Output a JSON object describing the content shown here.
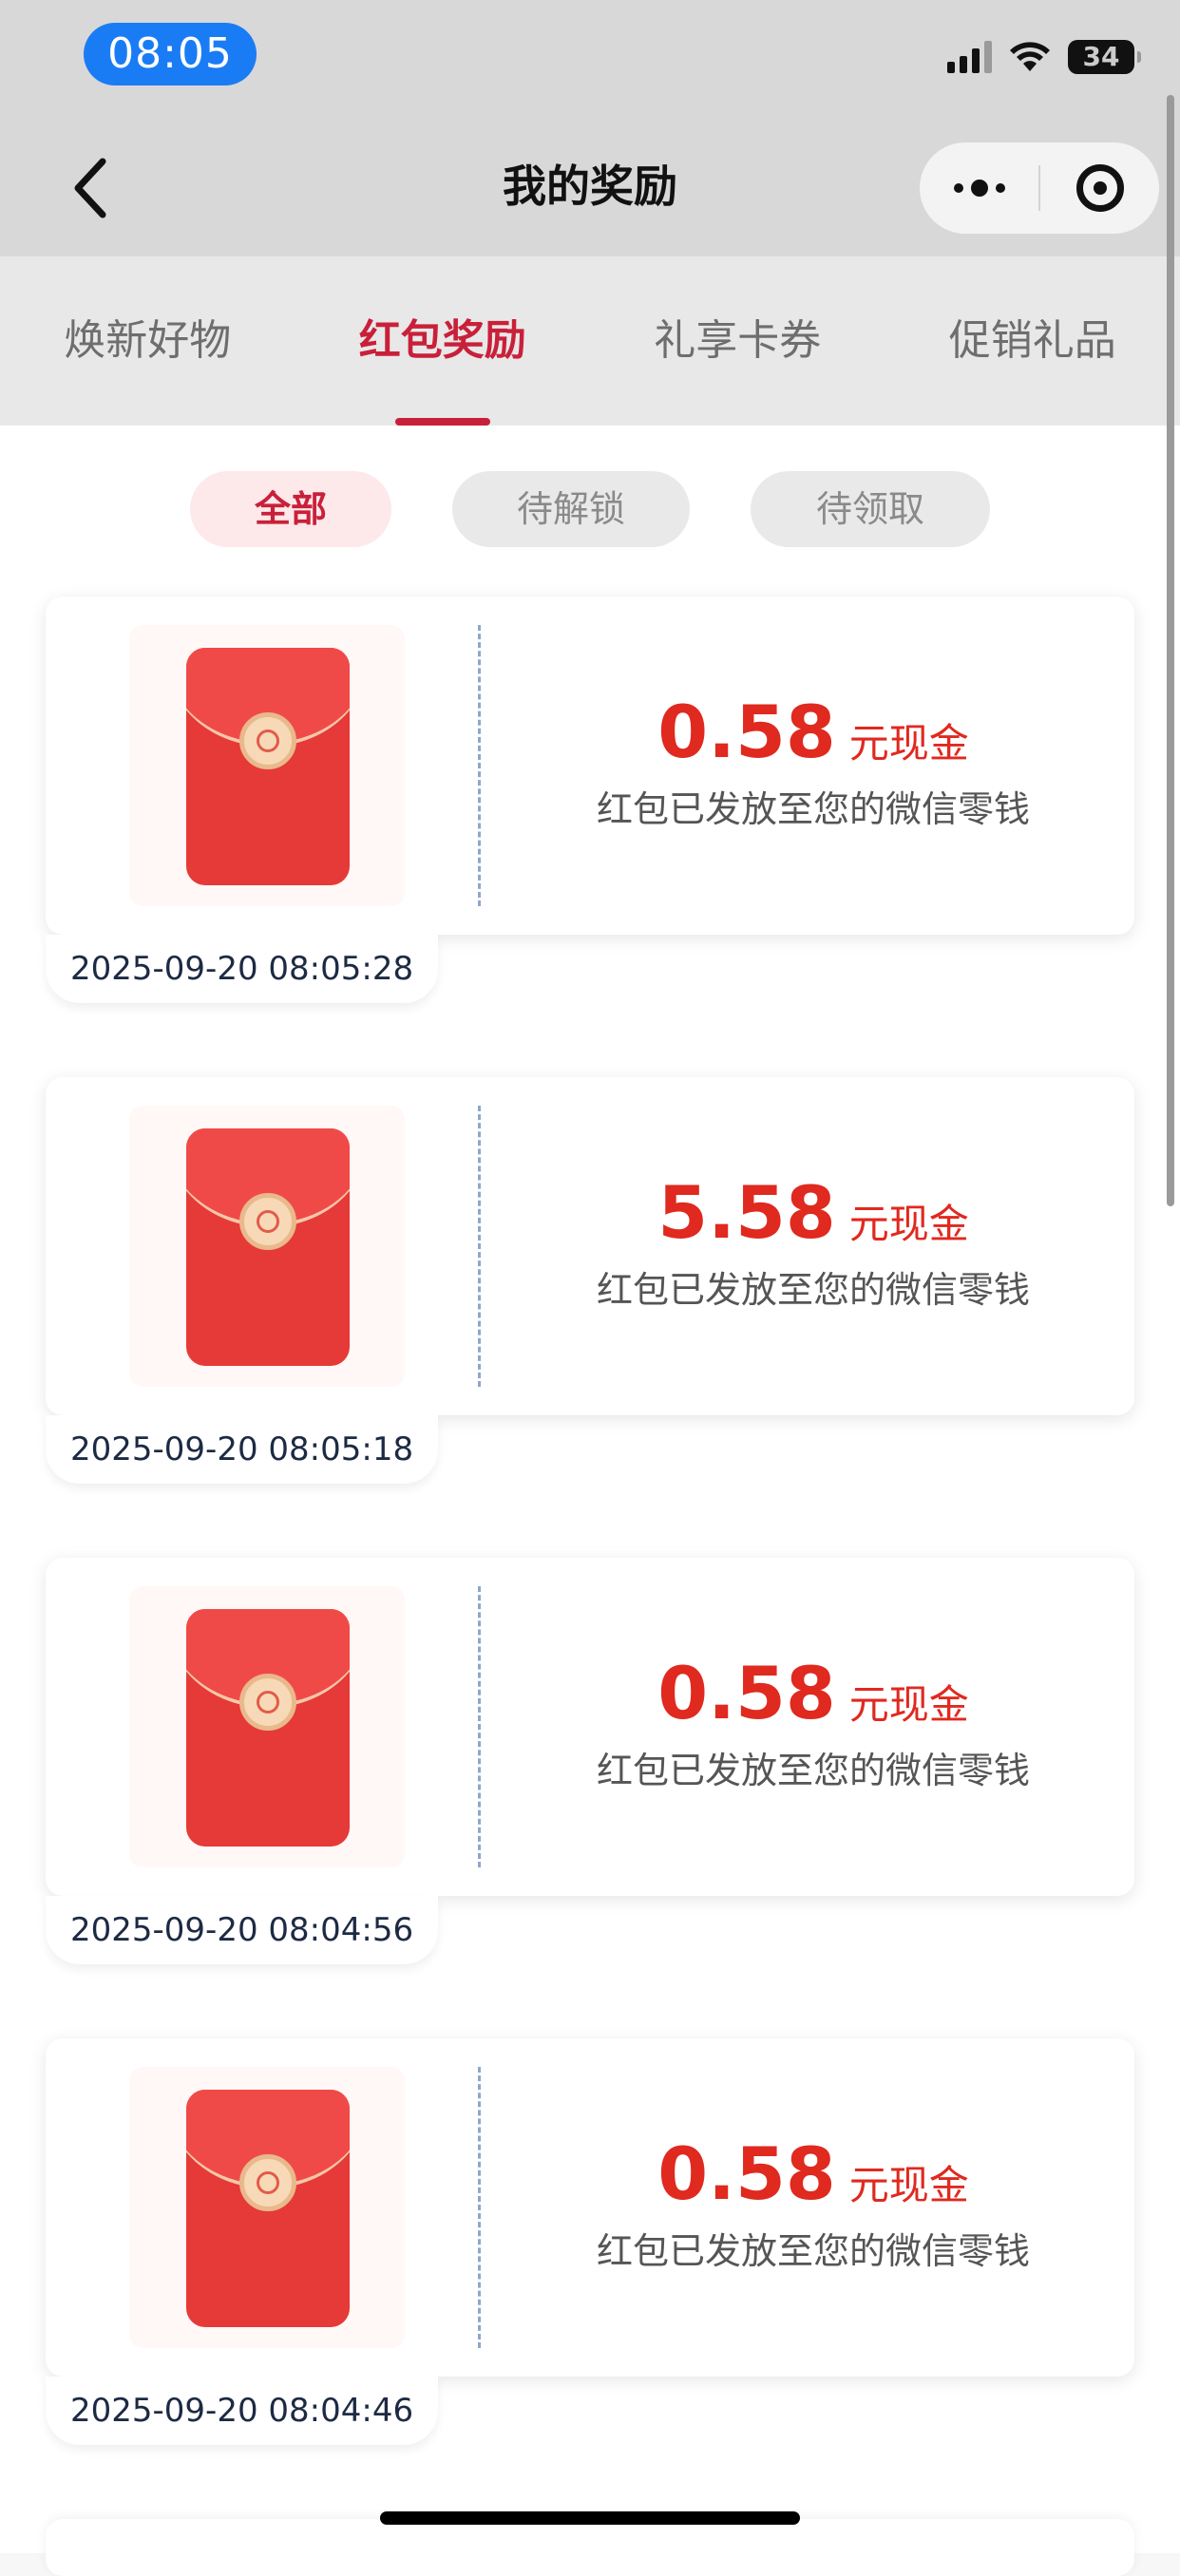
{
  "status_bar": {
    "time": "08:05",
    "battery": "34",
    "icons": [
      "signal-icon",
      "wifi-icon",
      "battery-icon"
    ]
  },
  "header": {
    "title": "我的奖励",
    "back_icon": "chevron-left-icon",
    "more_icon": "more-dots-icon",
    "close_icon": "target-icon"
  },
  "tabs": [
    {
      "label": "焕新好物",
      "active": false
    },
    {
      "label": "红包奖励",
      "active": true
    },
    {
      "label": "礼享卡券",
      "active": false
    },
    {
      "label": "促销礼品",
      "active": false
    }
  ],
  "filters": [
    {
      "label": "全部",
      "active": true
    },
    {
      "label": "待解锁",
      "active": false
    },
    {
      "label": "待领取",
      "active": false
    }
  ],
  "rewards": [
    {
      "amount": "0.58",
      "unit": "元现金",
      "description": "红包已发放至您的微信零钱",
      "timestamp": "2025-09-20 08:05:28"
    },
    {
      "amount": "5.58",
      "unit": "元现金",
      "description": "红包已发放至您的微信零钱",
      "timestamp": "2025-09-20 08:05:18"
    },
    {
      "amount": "0.58",
      "unit": "元现金",
      "description": "红包已发放至您的微信零钱",
      "timestamp": "2025-09-20 08:04:56"
    },
    {
      "amount": "0.58",
      "unit": "元现金",
      "description": "红包已发放至您的微信零钱",
      "timestamp": "2025-09-20 08:04:46"
    }
  ],
  "colors": {
    "accent": "#c9203a",
    "amount": "#e0291f",
    "status_pill": "#1a7cf5"
  }
}
